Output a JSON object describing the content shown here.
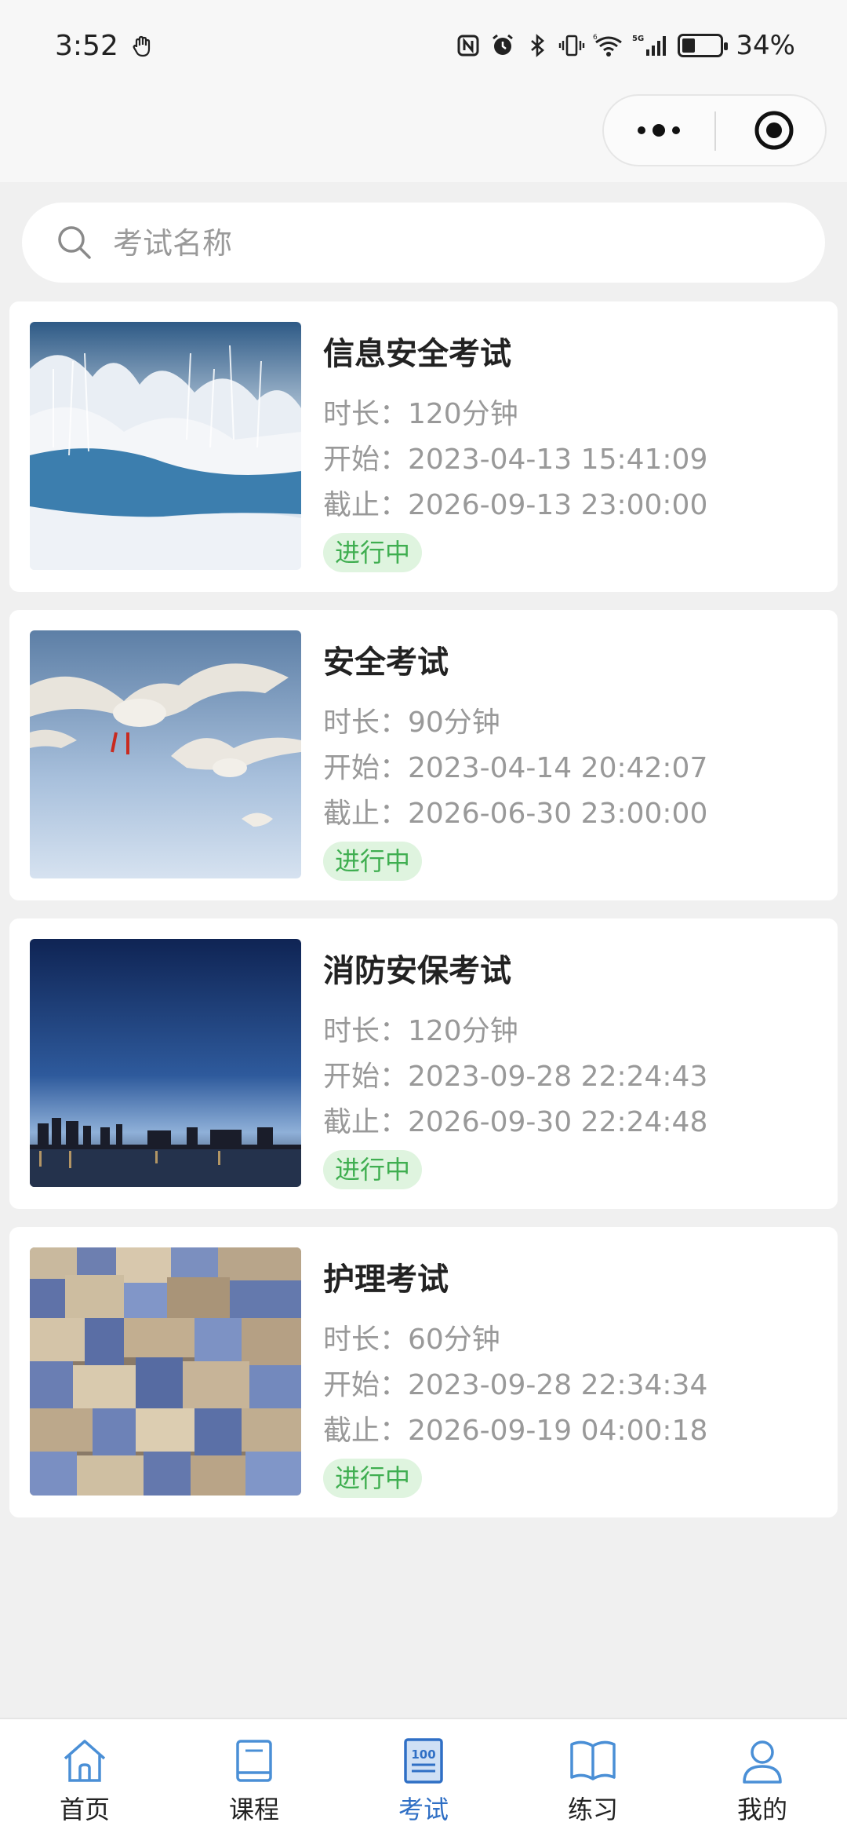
{
  "status_bar": {
    "time": "3:52",
    "battery": "34%",
    "network": "5G"
  },
  "search": {
    "placeholder": "考试名称"
  },
  "exams": [
    {
      "title": "信息安全考试",
      "duration": "时长：120分钟",
      "start": "开始：2023-04-13 15:41:09",
      "end": "截止：2026-09-13 23:00:00",
      "status": "进行中",
      "image": "snowy-river-photo"
    },
    {
      "title": "安全考试",
      "duration": "时长：90分钟",
      "start": "开始：2023-04-14 20:42:07",
      "end": "截止：2026-06-30 23:00:00",
      "status": "进行中",
      "image": "seagulls-photo"
    },
    {
      "title": "消防安保考试",
      "duration": "时长：120分钟",
      "start": "开始：2023-09-28 22:24:43",
      "end": "截止：2026-09-30 22:24:48",
      "status": "进行中",
      "image": "night-city-skyline-photo"
    },
    {
      "title": "护理考试",
      "duration": "时长：60分钟",
      "start": "开始：2023-09-28 22:34:34",
      "end": "截止：2026-09-19 04:00:18",
      "status": "进行中",
      "image": "blue-town-aerial-photo"
    }
  ],
  "tabbar": {
    "items": [
      {
        "label": "首页",
        "icon": "home-icon"
      },
      {
        "label": "课程",
        "icon": "book-icon"
      },
      {
        "label": "考试",
        "icon": "exam-icon"
      },
      {
        "label": "练习",
        "icon": "open-book-icon"
      },
      {
        "label": "我的",
        "icon": "user-icon"
      }
    ],
    "active_index": 2
  },
  "colors": {
    "accent": "#2f6fc5",
    "status_green": "#3fae50",
    "status_green_bg": "#dff4df",
    "page_bg": "#f0f0f0"
  }
}
